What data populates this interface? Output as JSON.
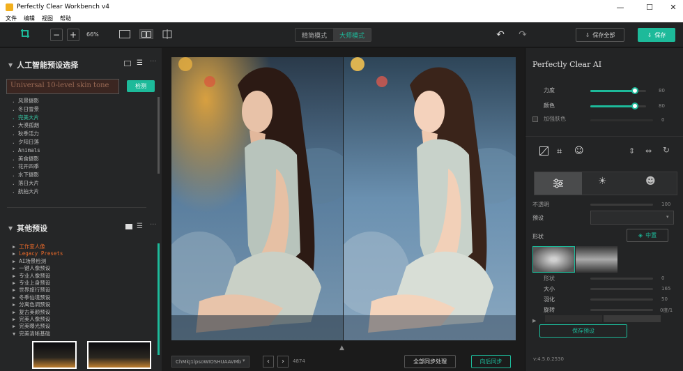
{
  "window": {
    "title": "Perfectly Clear Workbench v4",
    "min": "—",
    "max": "☐",
    "close": "✕"
  },
  "menu": [
    "文件",
    "编辑",
    "视图",
    "帮助"
  ],
  "toolbar": {
    "zoom": "66%",
    "minus": "−",
    "plus": "+",
    "mode_fine": "精简模式",
    "mode_master": "大师模式",
    "save_all": "保存全部",
    "save": "保存"
  },
  "left": {
    "ai_title": "人工智能预设选择",
    "search_value": "Universal 10-level skin tone",
    "detect": "检测",
    "ai_presets": [
      "风景摄影",
      "冬日雪景",
      "完美大片",
      "大漠孤烟",
      "秋季活力",
      "夕阳日落",
      "Animals",
      "美食摄影",
      "花开四季",
      "水下摄影",
      "落日大片",
      "航拍大片"
    ],
    "ai_selected_index": 2,
    "other_title": "其他预设",
    "other_presets": [
      {
        "label": "工作室人像",
        "style": "or",
        "open": false
      },
      {
        "label": "Legacy Presets",
        "style": "or",
        "open": false
      },
      {
        "label": "AI场景检测",
        "style": "",
        "open": false
      },
      {
        "label": "一键人像预设",
        "style": "",
        "open": false
      },
      {
        "label": "专业人像预设",
        "style": "",
        "open": false
      },
      {
        "label": "专业上身预设",
        "style": "",
        "open": false
      },
      {
        "label": "世界旅行预设",
        "style": "",
        "open": false
      },
      {
        "label": "冬季仙境预设",
        "style": "",
        "open": false
      },
      {
        "label": "分离色调预设",
        "style": "",
        "open": false
      },
      {
        "label": "复古美颜预设",
        "style": "",
        "open": false
      },
      {
        "label": "完美人像预设",
        "style": "",
        "open": false
      },
      {
        "label": "完美曝光预设",
        "style": "",
        "open": false
      },
      {
        "label": "完美清晰基础",
        "style": "",
        "open": true
      }
    ]
  },
  "center": {
    "filename": "ChMkJ1lpsoWIOSHUAAVMb",
    "page_counter": "4874",
    "sync_all": "全部同步处理",
    "sync_back": "向后同步"
  },
  "right": {
    "panel_title": "Perfectly Clear AI",
    "strength_label": "力度",
    "strength_value": "80",
    "strength_level": 0.8,
    "color_label": "颜色",
    "color_value": "80",
    "color_level": 0.8,
    "enhance_label": "加强肤色",
    "enhance_value": "0",
    "opacity_label": "不透明",
    "opacity_value": "100",
    "preset_label": "预设",
    "shape_label": "形状",
    "center_btn": "中置",
    "sh_shape": "形状",
    "sh_shape_val": "0",
    "sh_size": "大小",
    "sh_size_val": "165",
    "sh_feather": "羽化",
    "sh_feather_val": "50",
    "sh_rotate": "旋转",
    "sh_rotate_val": "0度/1",
    "save_preset": "保存预设",
    "version": "v:4.5.0.2530"
  },
  "colors": {
    "accent": "#1dba9a",
    "orange": "#e8692a"
  }
}
